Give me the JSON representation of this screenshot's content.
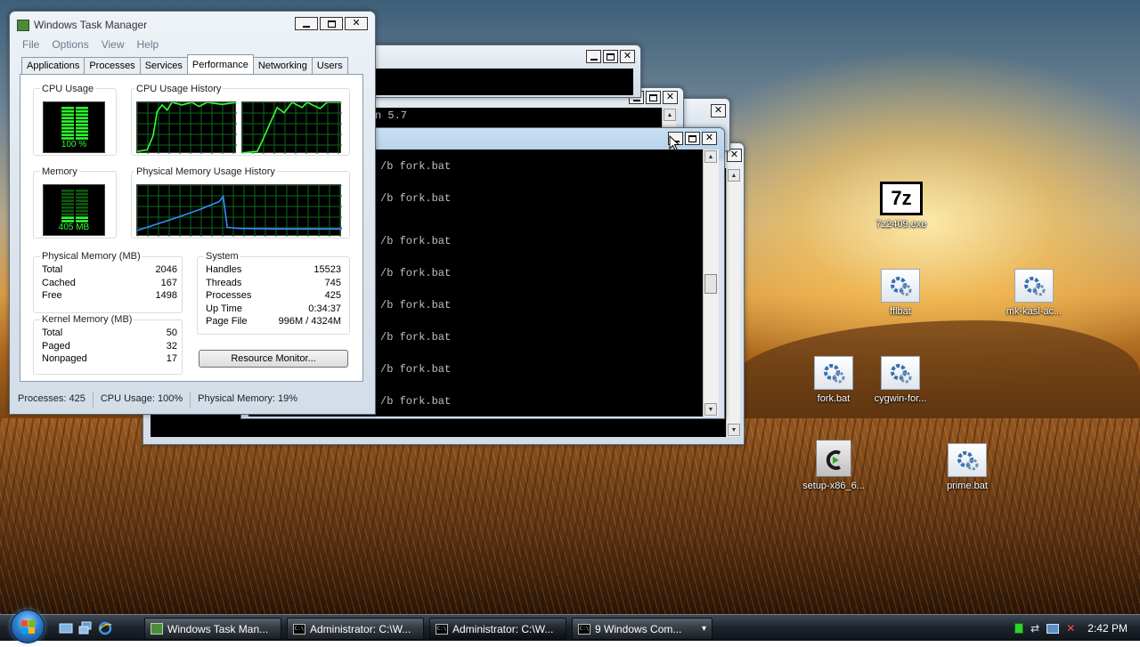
{
  "task_manager": {
    "title": "Windows Task Manager",
    "menu": [
      "File",
      "Options",
      "View",
      "Help"
    ],
    "tabs": [
      "Applications",
      "Processes",
      "Services",
      "Performance",
      "Networking",
      "Users"
    ],
    "active_tab": "Performance",
    "cpu_usage_label": "CPU Usage",
    "cpu_usage_value": "100 %",
    "cpu_history_label": "CPU Usage History",
    "memory_label": "Memory",
    "memory_value": "405 MB",
    "phys_history_label": "Physical Memory Usage History",
    "physical_memory": {
      "header": "Physical Memory (MB)",
      "rows": [
        {
          "label": "Total",
          "value": "2046"
        },
        {
          "label": "Cached",
          "value": "167"
        },
        {
          "label": "Free",
          "value": "1498"
        }
      ]
    },
    "kernel_memory": {
      "header": "Kernel Memory (MB)",
      "rows": [
        {
          "label": "Total",
          "value": "50"
        },
        {
          "label": "Paged",
          "value": "32"
        },
        {
          "label": "Nonpaged",
          "value": "17"
        }
      ]
    },
    "system": {
      "header": "System",
      "rows": [
        {
          "label": "Handles",
          "value": "15523"
        },
        {
          "label": "Threads",
          "value": "745"
        },
        {
          "label": "Processes",
          "value": "425"
        },
        {
          "label": "Up Time",
          "value": "0:34:37"
        },
        {
          "label": "Page File",
          "value": "996M / 4324M"
        }
      ]
    },
    "resource_monitor_button": "Resource Monitor...",
    "status": {
      "processes": "Processes: 425",
      "cpu": "CPU Usage: 100%",
      "memory": "Physical Memory: 19%"
    },
    "memory_level": 0.19,
    "cpu_level": 1.0
  },
  "console": {
    "lines": [
      "/b fork.bat",
      "/b fork.bat",
      "/b fork.bat",
      "/b fork.bat",
      "/b fork.bat",
      "/b fork.bat",
      "/b fork.bat",
      "/b fork.bat"
    ],
    "back_text": "n 5.7"
  },
  "desktop_icons": [
    {
      "label": "7z2409.exe",
      "icon": "7zip-icon"
    },
    {
      "label": "fflbat",
      "icon": "batch-file-icon"
    },
    {
      "label": "mk-kasl-ac...",
      "icon": "batch-file-icon"
    },
    {
      "label": "fork.bat",
      "icon": "batch-file-icon"
    },
    {
      "label": "cygwin-for...",
      "icon": "batch-file-icon"
    },
    {
      "label": "setup-x86_6...",
      "icon": "cygwin-setup-icon"
    },
    {
      "label": "prime.bat",
      "icon": "batch-file-icon"
    }
  ],
  "taskbar": {
    "buttons": [
      {
        "label": "Windows Task Man...",
        "icon": "task-manager-icon"
      },
      {
        "label": "Administrator: C:\\W...",
        "icon": "cmd-icon"
      },
      {
        "label": "Administrator: C:\\W...",
        "icon": "cmd-icon"
      },
      {
        "label": "9 Windows Com...",
        "icon": "cmd-icon"
      }
    ],
    "clock": "2:42 PM",
    "seven_zip_glyph": "7z",
    "cmd_glyph": "C:\\",
    "group_arrow": "▾"
  }
}
